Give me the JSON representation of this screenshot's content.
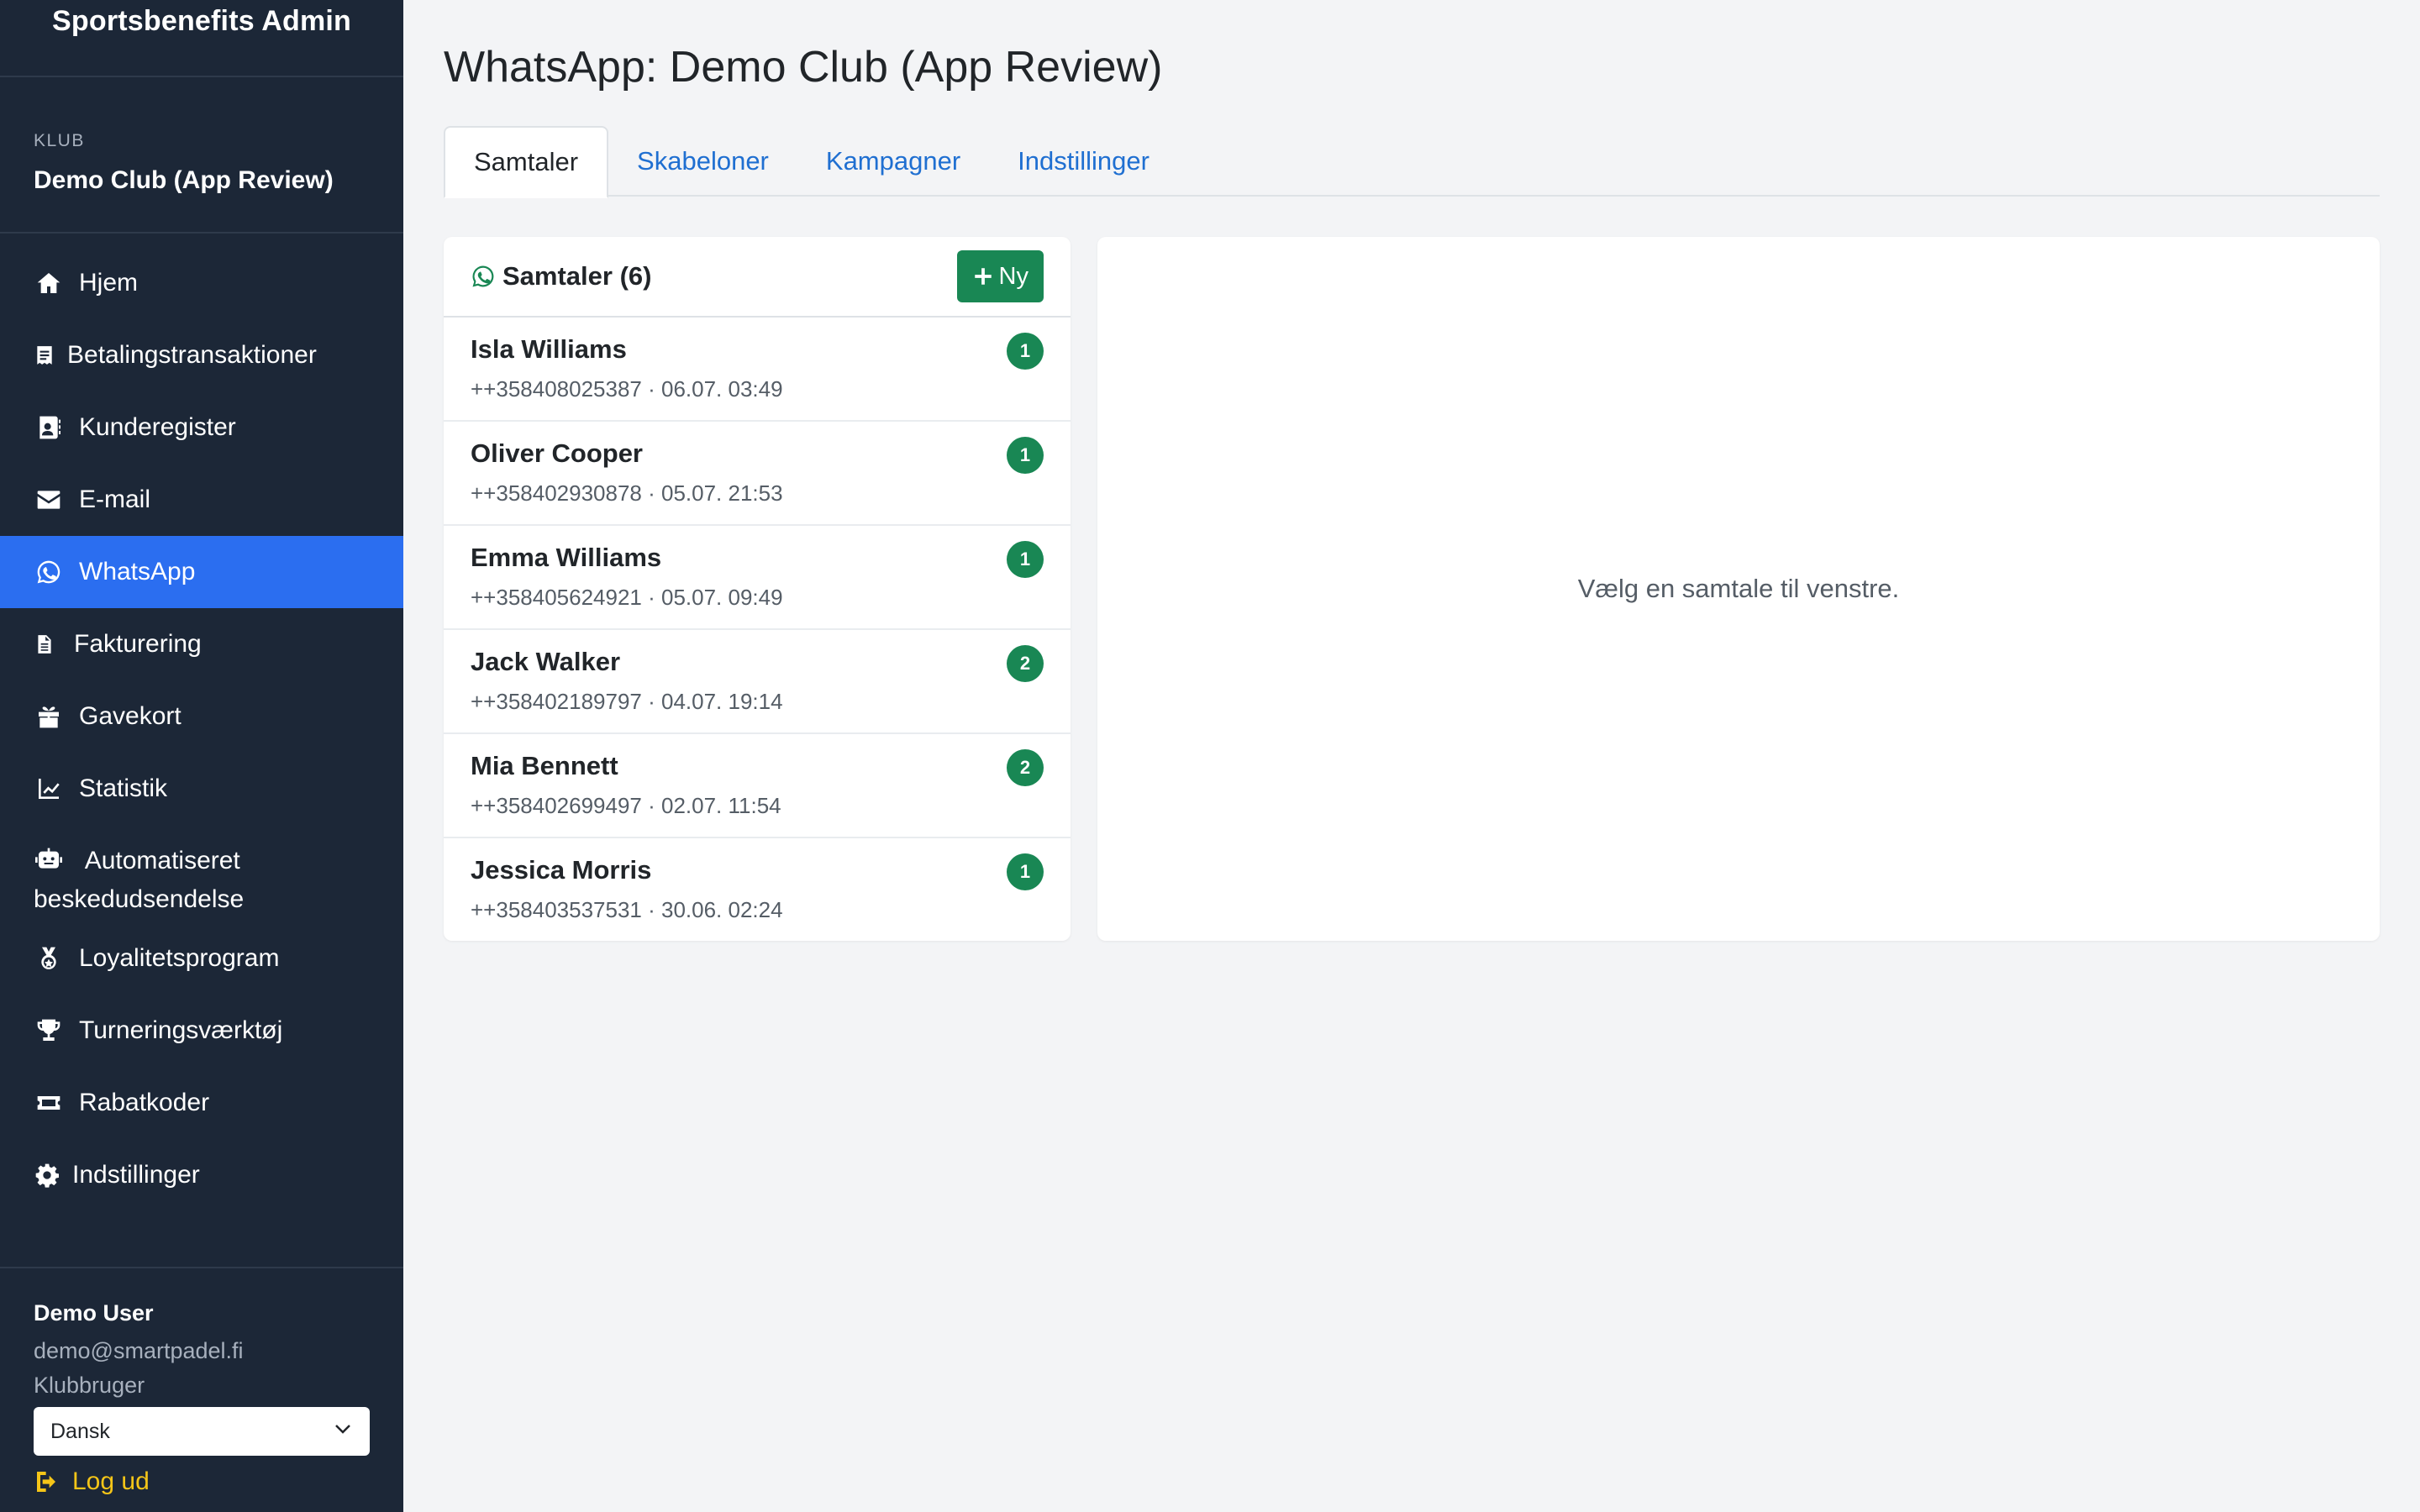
{
  "brand": "Sportsbenefits Admin",
  "club": {
    "caption": "KLUB",
    "name": "Demo Club (App Review)"
  },
  "nav": [
    {
      "label": "Hjem",
      "icon": "home-icon",
      "active": false
    },
    {
      "label": "Betalingstransaktioner",
      "icon": "receipt-icon",
      "active": false
    },
    {
      "label": "Kunderegister",
      "icon": "contact-card-icon",
      "active": false
    },
    {
      "label": "E-mail",
      "icon": "envelope-icon",
      "active": false
    },
    {
      "label": "WhatsApp",
      "icon": "whatsapp-icon",
      "active": true
    },
    {
      "label": "Fakturering",
      "icon": "document-icon",
      "active": false
    },
    {
      "label": "Gavekort",
      "icon": "gift-icon",
      "active": false
    },
    {
      "label": "Statistik",
      "icon": "line-chart-icon",
      "active": false
    },
    {
      "label_line1": "Automatiseret",
      "label_line2": "beskedudsendelse",
      "icon": "robot-icon",
      "active": false
    },
    {
      "label": "Loyalitetsprogram",
      "icon": "medal-icon",
      "active": false
    },
    {
      "label": "Turneringsværktøj",
      "icon": "trophy-icon",
      "active": false
    },
    {
      "label": "Rabatkoder",
      "icon": "ticket-icon",
      "active": false
    },
    {
      "label": "Indstillinger",
      "icon": "gear-icon",
      "active": false
    }
  ],
  "user": {
    "name": "Demo User",
    "email": "demo@smartpadel.fi",
    "role": "Klubbruger"
  },
  "language": {
    "selected": "Dansk"
  },
  "logout_label": "Log ud",
  "page_title": "WhatsApp: Demo Club (App Review)",
  "tabs": [
    {
      "label": "Samtaler",
      "active": true
    },
    {
      "label": "Skabeloner",
      "active": false
    },
    {
      "label": "Kampagner",
      "active": false
    },
    {
      "label": "Indstillinger",
      "active": false
    }
  ],
  "conversations": {
    "title": "Samtaler (6)",
    "new_label": "Ny",
    "items": [
      {
        "name": "Isla Williams",
        "meta": "++358408025387 · 06.07. 03:49",
        "unread": "1"
      },
      {
        "name": "Oliver Cooper",
        "meta": "++358402930878 · 05.07. 21:53",
        "unread": "1"
      },
      {
        "name": "Emma Williams",
        "meta": "++358405624921 · 05.07. 09:49",
        "unread": "1"
      },
      {
        "name": "Jack Walker",
        "meta": "++358402189797 · 04.07. 19:14",
        "unread": "2"
      },
      {
        "name": "Mia Bennett",
        "meta": "++358402699497 · 02.07. 11:54",
        "unread": "2"
      },
      {
        "name": "Jessica Morris",
        "meta": "++358403537531 · 30.06. 02:24",
        "unread": "1"
      }
    ]
  },
  "detail": {
    "empty_text": "Vælg en samtale til venstre."
  },
  "colors": {
    "sidebar_bg": "#1c2737",
    "active_nav": "#2b6ef0",
    "accent_green": "#198754",
    "tab_link": "#1f6fd1",
    "logout": "#f5c518"
  }
}
